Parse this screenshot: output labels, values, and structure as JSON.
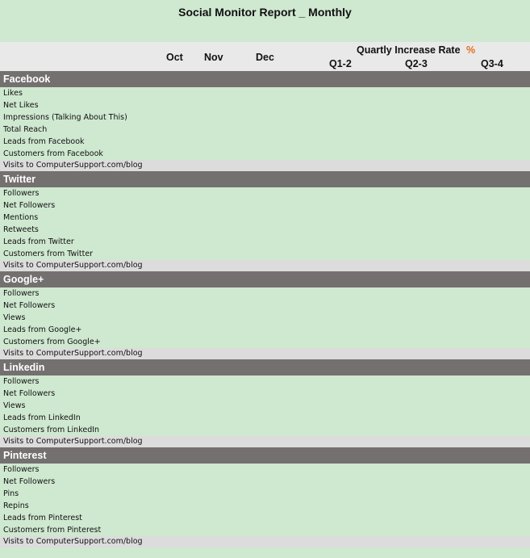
{
  "report": {
    "title": "Social Monitor Report _ Monthly",
    "columns": {
      "oct": "Oct",
      "nov": "Nov",
      "dec": "Dec",
      "rate_label": "Quartly Increase Rate",
      "rate_unit": "%",
      "q1": "Q1-2",
      "q2": "Q2-3",
      "q3": "Q3-4"
    }
  },
  "sections": [
    {
      "name": "Facebook",
      "rows": [
        "Likes",
        "Net Likes",
        "Impressions (Talking About This)",
        "Total Reach",
        "Leads from Facebook",
        "Customers from Facebook"
      ],
      "visits": "Visits to ComputerSupport.com/blog"
    },
    {
      "name": "Twitter",
      "rows": [
        "Followers",
        "Net Followers",
        "Mentions",
        "Retweets",
        "Leads from Twitter",
        "Customers from Twitter"
      ],
      "visits": "Visits to ComputerSupport.com/blog"
    },
    {
      "name": "Google+",
      "rows": [
        "Followers",
        "Net Followers",
        "Views",
        "Leads from Google+",
        "Customers from Google+"
      ],
      "visits": "Visits to ComputerSupport.com/blog"
    },
    {
      "name": "Linkedin",
      "rows": [
        "Followers",
        "Net Followers",
        "Views",
        "Leads from LinkedIn",
        "Customers from LinkedIn"
      ],
      "visits": "Visits to ComputerSupport.com/blog"
    },
    {
      "name": "Pinterest",
      "rows": [
        "Followers",
        "Net Followers",
        "Pins",
        "Repins",
        "Leads from Pinterest",
        "Customers from Pinterest"
      ],
      "visits": "Visits to ComputerSupport.com/blog"
    }
  ]
}
